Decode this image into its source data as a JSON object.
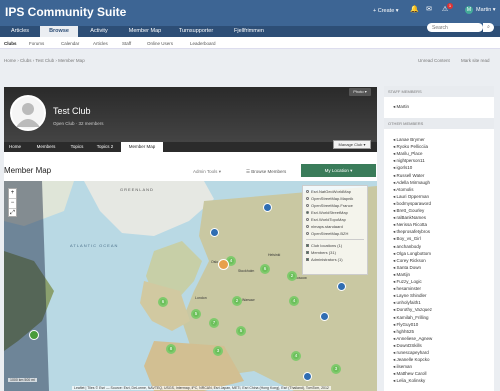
{
  "header": {
    "site_title": "IPS Community Suite",
    "create_label": "Create",
    "user_name": "Martin",
    "notification_count": "1",
    "avatar_letter": "M",
    "search_placeholder": "Search"
  },
  "nav": {
    "tabs": [
      "Articles",
      "Browse",
      "Activity",
      "Member Map",
      "Turnsupporter",
      "Fjellfrimmen"
    ],
    "active": "Browse"
  },
  "subnav": {
    "items": [
      "Clubs",
      "Forums",
      "Calendar",
      "Articles",
      "Staff",
      "Online Users",
      "Leaderboard"
    ]
  },
  "breadcrumb": {
    "text": "Home › Clubs › Test Club › Member Map",
    "unread": "Unread Content",
    "mark_read": "Mark site read"
  },
  "club": {
    "name": "Test Club",
    "meta": "Open Club · 32 members",
    "photo_label": "Photo",
    "tabs": [
      "Home",
      "Members",
      "Topics",
      "Topics 2",
      "Member Map"
    ],
    "active_tab": "Member Map",
    "manage_label": "Manage Club"
  },
  "map": {
    "title": "Member Map",
    "admin_tools": "Admin Tools",
    "browse_members": "Browse Members",
    "my_location": "My Location",
    "zoom_in": "+",
    "zoom_out": "−",
    "fullscreen": "⤢",
    "scale_label": "1000 km\n500 mi",
    "attribution": "Leaflet | Tiles © Esri — Source: Esri, DeLorme, NAVTEQ, USGS, Intermap, iPC, NRCAN, Esri Japan, METI, Esri China (Hong Kong), Esri (Thailand), TomTom, 2012",
    "layers": [
      "Esri.NatGeoWorldMap",
      "OpenStreetMap.Mapnik",
      "OpenStreetMap.France",
      "Esri.WorldStreetMap",
      "Esri.WorldTopoMap",
      "nlmaps.standaard",
      "OpenStreetMap.BZH"
    ],
    "selected_layer": "Esri.WorldStreetMap",
    "overlays": [
      "Club locations (1)",
      "Members (31)",
      "Administrators (1)"
    ],
    "clusters": [
      "6",
      "5",
      "4",
      "6",
      "2",
      "2",
      "7",
      "5",
      "4",
      "8",
      "3",
      "3",
      "4"
    ],
    "city_labels": [
      "Stockholm",
      "Oslo",
      "Helsinki",
      "London",
      "Warsaw",
      "Moscow"
    ],
    "region_labels": [
      "GREENLAND",
      "ATLANTIC OCEAN"
    ]
  },
  "sidebar": {
    "staff_header": "STAFF MEMBERS",
    "staff": [
      "Martin"
    ],
    "other_header": "OTHER MEMBERS",
    "others": [
      "Lanae Brymer",
      "Ryoko Pellicciia",
      "Marilu_Place",
      "nightperson11",
      "igorls10",
      "Russell Water",
      "Adella Mirmaugh",
      "Atomolis",
      "Lauri Opperman",
      "bodmysparaword",
      "Brett_Gourley",
      "ralBankNames",
      "Nerissa Ricotta",
      "theprosafetybros",
      "Boy_vs_Girl",
      "anchanbody",
      "Olga Longbottom",
      "Corey Rickson",
      "Santa Down",
      "Martijn",
      "Fuzzy_Logic",
      "hesaminster",
      "Layne Shindler",
      "unholyfaith1",
      "Dorothy_Vazquez",
      "Kamilah_Frilling",
      "FlyGuy010",
      "hghh525",
      "Anneliese_Agnew",
      "DownDSkills",
      "runescapeyhard",
      "Jeanelle Kopcko",
      "ilseman",
      "Matthew Caroll",
      "Lelia_Kolinsky"
    ]
  }
}
